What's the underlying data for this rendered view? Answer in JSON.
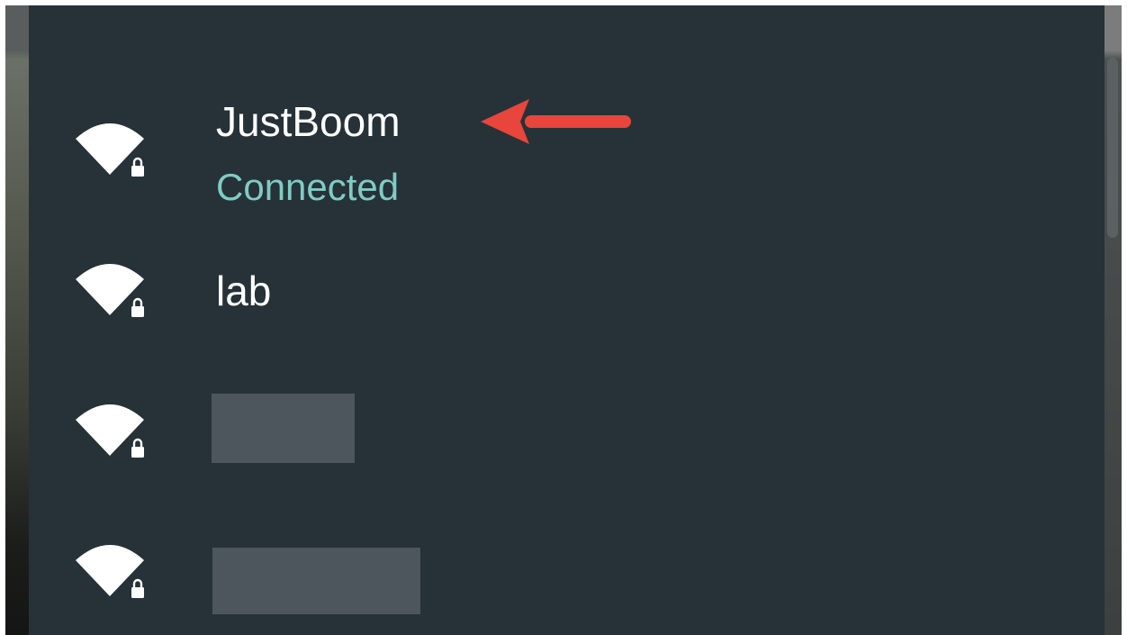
{
  "networks": [
    {
      "ssid": "JustBoom",
      "status": "Connected",
      "icon": "wifi-lock-icon",
      "redacted": false
    },
    {
      "ssid": "lab",
      "status": "",
      "icon": "wifi-lock-icon",
      "redacted": false
    },
    {
      "ssid": "",
      "status": "",
      "icon": "wifi-lock-icon",
      "redacted": true
    },
    {
      "ssid": "",
      "status": "",
      "icon": "wifi-lock-icon",
      "redacted": true
    }
  ],
  "annotation": {
    "icon": "left-arrow-icon",
    "color": "#e8453c"
  },
  "colors": {
    "panel": "#263238",
    "text": "#ffffff",
    "connected": "#80cbc4",
    "redaction": "#4c565c"
  }
}
